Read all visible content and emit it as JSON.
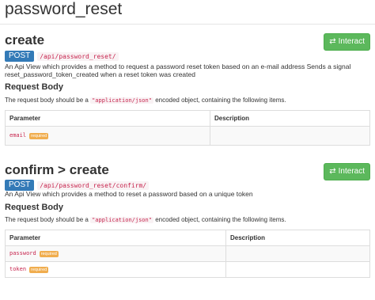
{
  "page": {
    "title": "password_reset"
  },
  "sections": [
    {
      "title": "create",
      "interact_label": "Interact",
      "method": "POST",
      "path": "/api/password_reset/",
      "description": "An Api View which provides a method to request a password reset token based on an e-mail address Sends a signal reset_password_token_created when a reset token was created",
      "request_body_title": "Request Body",
      "request_body_text_before": "The request body should be a",
      "request_body_content_type": "\"application/json\"",
      "request_body_text_after": "encoded object, containing the following items.",
      "table_headers": [
        "Parameter",
        "Description"
      ],
      "params": [
        {
          "name": "email",
          "badge": "required",
          "description": ""
        }
      ]
    },
    {
      "title": "confirm > create",
      "interact_label": "Interact",
      "method": "POST",
      "path": "/api/password_reset/confirm/",
      "description": "An Api View which provides a method to reset a password based on a unique token",
      "request_body_title": "Request Body",
      "request_body_text_before": "The request body should be a",
      "request_body_content_type": "\"application/json\"",
      "request_body_text_after": "encoded object, containing the following items.",
      "table_headers": [
        "Parameter",
        "Description"
      ],
      "params": [
        {
          "name": "password",
          "badge": "required",
          "description": ""
        },
        {
          "name": "token",
          "badge": "required",
          "description": ""
        }
      ]
    }
  ],
  "colors": {
    "interact_button": "#5cb85c",
    "method_badge": "#337ab7",
    "required_badge": "#f0ad4e",
    "code_text": "#c7254e"
  },
  "icons": {
    "interact": "swap-arrows-icon"
  }
}
